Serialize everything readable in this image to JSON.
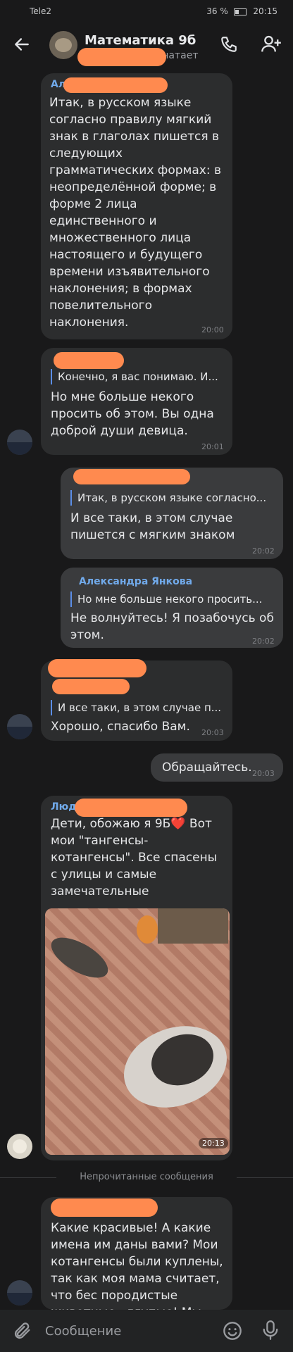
{
  "status_bar": {
    "carrier": "Tele2",
    "battery": "36 %",
    "time": "20:15"
  },
  "header": {
    "title": "Математика 9б",
    "subtitle": "...печатает"
  },
  "messages": [
    {
      "author": "Алексан...",
      "text": "Итак, в русском языке согласно правилу мягкий знак в глаголах пишется в следующих грамматических формах: в неопределённой форме; в форме 2 лица единственного и множественного лица настоящего и будущего времени изъявительного наклонения; в формах повелительного наклонения.",
      "time": "20:00"
    },
    {
      "reply_text": "Конечно, я вас понимаю. И...",
      "text": "Но мне больше некого просить об этом. Вы одна доброй души девица.",
      "time": "20:01"
    },
    {
      "reply_text": "Итак, в русском языке согласно...",
      "text": "И все таки, в этом случае пишется с мягким знаком",
      "time": "20:02"
    },
    {
      "reply_author": "Александра Янкова",
      "reply_text": "Но мне больше некого просить...",
      "text": "Не волнуйтесь! Я позабочусь об этом.",
      "time": "20:02"
    },
    {
      "reply_text": "И все таки, в этом случае п...",
      "text": "Хорошо, спасибо Вам.",
      "time": "20:03"
    },
    {
      "text": "Обращайтесь.",
      "time": "20:03"
    },
    {
      "author": "Люд...",
      "text": "Дети, обожаю я 9Б❤️ Вот мои \"тангенсы-котангенсы\". Все спасены с улицы и самые замечательные",
      "time": "20:13"
    },
    {
      "text": "Какие красивые! А какие имена им даны вами? Мои котангенсы были куплены, так как моя мама считает, что бес породистые животные - глупые! Мы их...",
      "time": ""
    }
  ],
  "divider": "Непрочитанные сообщения",
  "composer": {
    "placeholder": "Сообщение"
  },
  "colors": {
    "background": "#19191a",
    "bubble_in": "#2c2d2e",
    "bubble_out": "#3a3b3d",
    "accent": "#71aaeb",
    "redaction": "#ff8a4f"
  }
}
